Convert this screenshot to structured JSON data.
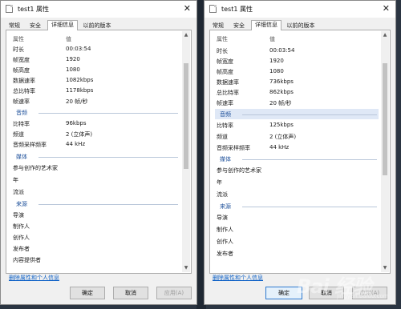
{
  "left": {
    "title": "test1 属性",
    "close": "✕",
    "tabs": [
      "常规",
      "安全",
      "详细信息",
      "以前的版本"
    ],
    "header": {
      "k": "属性",
      "v": "值"
    },
    "rows": [
      {
        "k": "时长",
        "v": "00:03:54"
      },
      {
        "k": "帧宽度",
        "v": "1920"
      },
      {
        "k": "帧高度",
        "v": "1080"
      },
      {
        "k": "数据速率",
        "v": "1082kbps"
      },
      {
        "k": "总比特率",
        "v": "1178kbps"
      },
      {
        "k": "帧速率",
        "v": "20 帧/秒"
      }
    ],
    "audio": {
      "title": "音频",
      "rows": [
        {
          "k": "比特率",
          "v": "96kbps"
        },
        {
          "k": "频道",
          "v": "2 (立体声)"
        },
        {
          "k": "音频采样频率",
          "v": "44 kHz"
        }
      ]
    },
    "media": {
      "title": "媒体",
      "rows": [
        {
          "k": "参与创作的艺术家",
          "v": ""
        },
        {
          "k": "年",
          "v": ""
        },
        {
          "k": "流派",
          "v": ""
        }
      ]
    },
    "origin": {
      "title": "来源",
      "rows": [
        {
          "k": "导演",
          "v": ""
        },
        {
          "k": "制作人",
          "v": ""
        },
        {
          "k": "创作人",
          "v": ""
        },
        {
          "k": "发布者",
          "v": ""
        },
        {
          "k": "内容提供者",
          "v": ""
        }
      ]
    },
    "remove_link": "删除属性和个人信息",
    "ok": "确定",
    "cancel": "取消",
    "apply": "应用(A)"
  },
  "right": {
    "title": "test1 属性",
    "close": "✕",
    "tabs": [
      "常规",
      "安全",
      "详细信息",
      "以前的版本"
    ],
    "header": {
      "k": "属性",
      "v": "值"
    },
    "rows": [
      {
        "k": "时长",
        "v": "00:03:54"
      },
      {
        "k": "帧宽度",
        "v": "1920"
      },
      {
        "k": "帧高度",
        "v": "1080"
      },
      {
        "k": "数据速率",
        "v": "736kbps"
      },
      {
        "k": "总比特率",
        "v": "862kbps"
      },
      {
        "k": "帧速率",
        "v": "20 帧/秒"
      }
    ],
    "audio": {
      "title": "音频",
      "rows": [
        {
          "k": "比特率",
          "v": "125kbps"
        },
        {
          "k": "频道",
          "v": "2 (立体声)"
        },
        {
          "k": "音频采样频率",
          "v": "44 kHz"
        }
      ]
    },
    "media": {
      "title": "媒体",
      "rows": [
        {
          "k": "参与创作的艺术家",
          "v": ""
        },
        {
          "k": "年",
          "v": ""
        },
        {
          "k": "流派",
          "v": ""
        }
      ]
    },
    "origin": {
      "title": "来源",
      "rows": [
        {
          "k": "导演",
          "v": ""
        },
        {
          "k": "制作人",
          "v": ""
        },
        {
          "k": "创作人",
          "v": ""
        },
        {
          "k": "发布者",
          "v": ""
        }
      ]
    },
    "remove_link": "删除属性和个人信息",
    "ok": "确定",
    "cancel": "取消",
    "apply": "应用(A)"
  },
  "watermark": "Bai 经验",
  "watermark_sub": "jingyan.baidu.com",
  "colors": {
    "accent": "#2e7ad0",
    "link": "#0b5fc6",
    "section": "#1c4f9a",
    "selection": "#dfe8f6"
  }
}
